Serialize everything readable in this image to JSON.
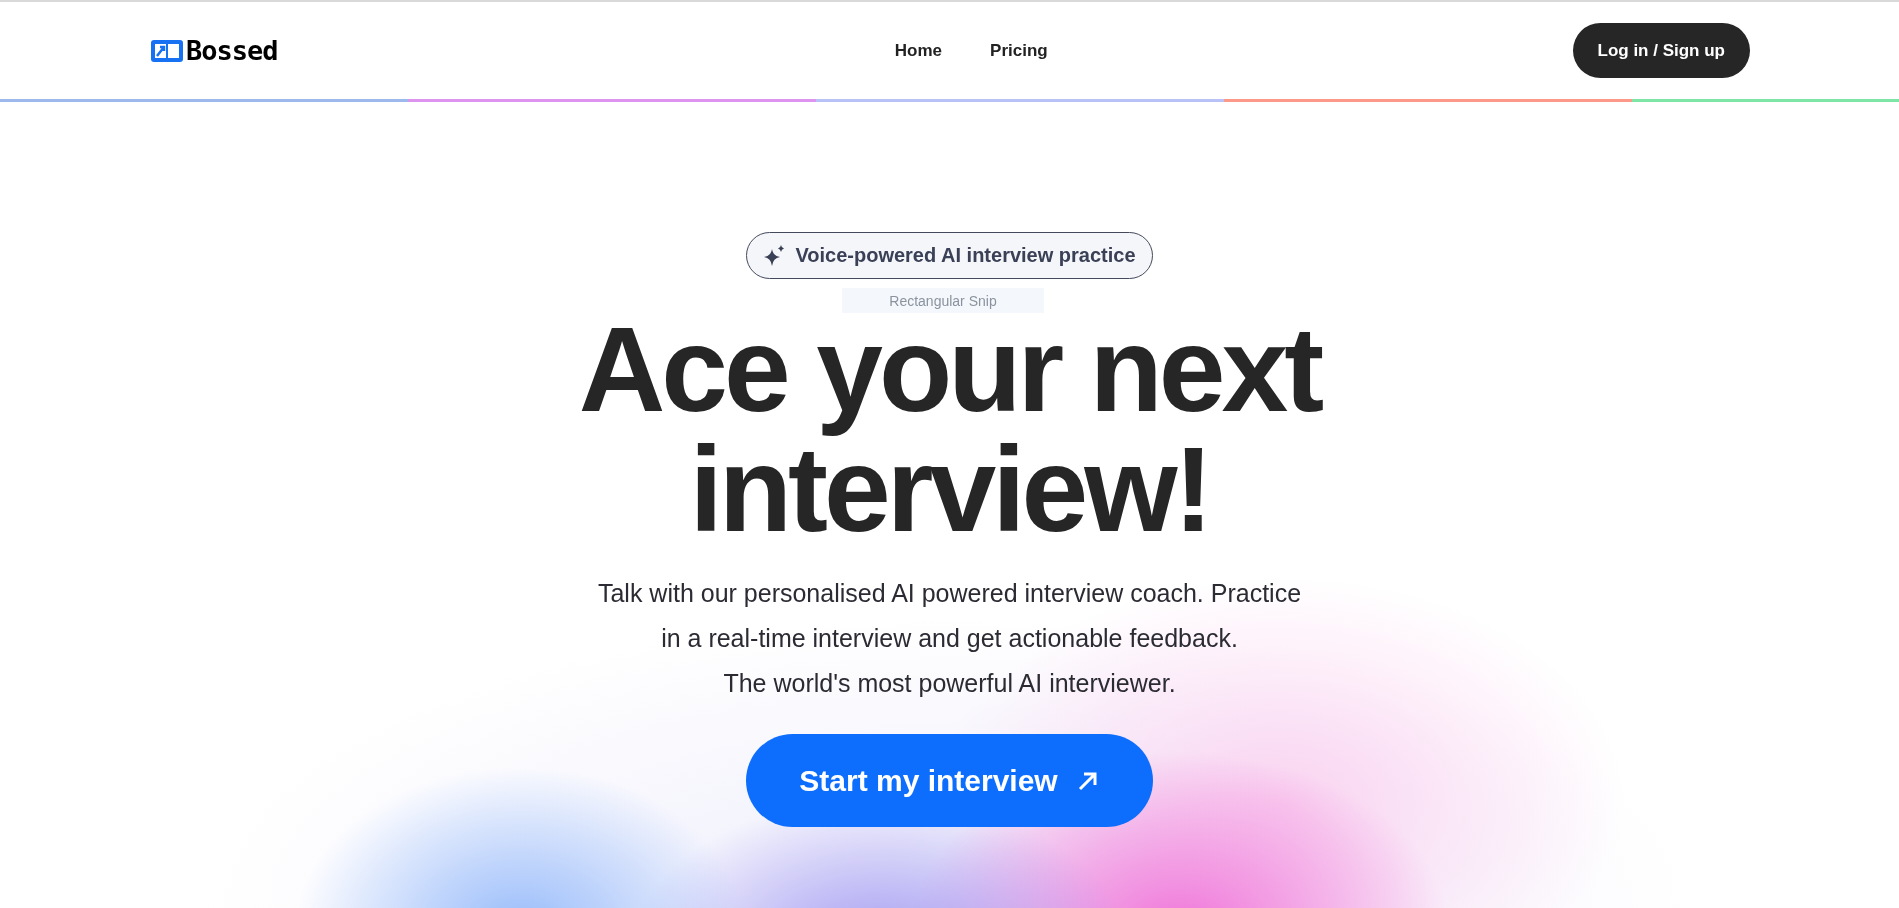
{
  "header": {
    "logo": "Bossed",
    "nav": [
      {
        "label": "Home"
      },
      {
        "label": "Pricing"
      }
    ],
    "login_button": "Log in / Sign up"
  },
  "accent_bar": [
    {
      "color": "#9db8ea"
    },
    {
      "color": "#dc94ee"
    },
    {
      "color": "#b9c2f6"
    },
    {
      "color": "#fd998a"
    },
    {
      "color": "#7de5a5"
    }
  ],
  "hero": {
    "badge": "Voice-powered AI interview practice",
    "tooltip": "Rectangular Snip",
    "heading": [
      "Ace your next",
      "interview!"
    ],
    "description": [
      "Talk with our personalised AI powered interview coach. Practice",
      "in a real-time interview and get actionable feedback.",
      "The world's most powerful AI interviewer."
    ],
    "cta_button": "Start my interview"
  }
}
